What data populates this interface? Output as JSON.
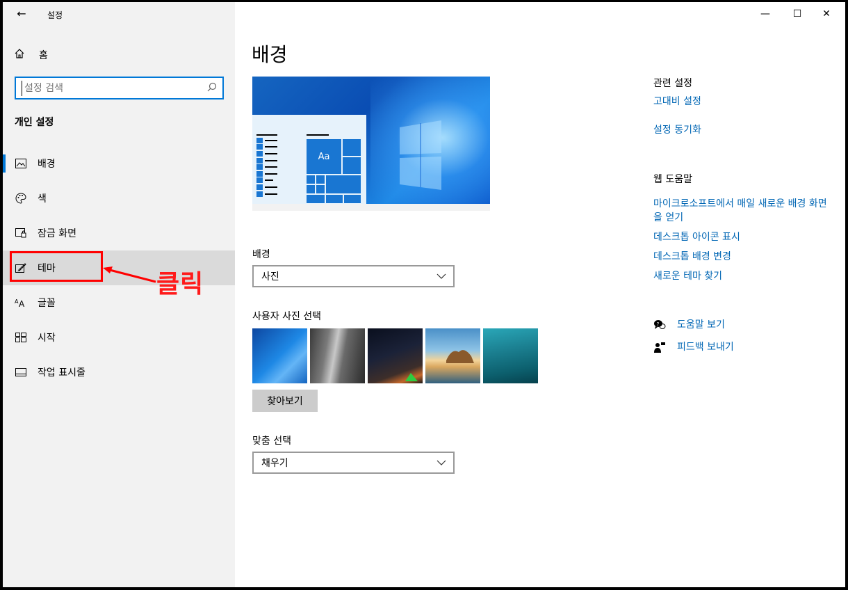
{
  "app": {
    "title": "설정",
    "back_glyph": "←"
  },
  "window_controls": {
    "minimize": "—",
    "maximize": "☐",
    "close": "✕"
  },
  "sidebar": {
    "home_label": "홈",
    "search_placeholder": "설정 검색",
    "section_title": "개인 설정",
    "items": [
      {
        "label": "배경",
        "icon": "picture-icon",
        "glyph": "🖼"
      },
      {
        "label": "색",
        "icon": "palette-icon",
        "glyph": "🎨"
      },
      {
        "label": "잠금 화면",
        "icon": "lock-screen-icon",
        "glyph": "⎘"
      },
      {
        "label": "테마",
        "icon": "theme-brush-icon",
        "glyph": "✎"
      },
      {
        "label": "글꼴",
        "icon": "font-icon",
        "glyph": "ᴬA"
      },
      {
        "label": "시작",
        "icon": "start-grid-icon",
        "glyph": "⊞"
      },
      {
        "label": "작업 표시줄",
        "icon": "taskbar-icon",
        "glyph": "▭"
      }
    ]
  },
  "annotation": {
    "text": "클릭"
  },
  "main": {
    "title": "배경",
    "preview_tile_text": "Aa",
    "background_label": "배경",
    "background_value": "사진",
    "photo_label": "사용자 사진 선택",
    "browse_label": "찾아보기",
    "fit_label": "맞춤 선택",
    "fit_value": "채우기"
  },
  "related": {
    "title": "관련 설정",
    "links": [
      "고대비 설정",
      "설정 동기화"
    ]
  },
  "web_help": {
    "title": "웹 도움말",
    "links": [
      "마이크로소프트에서 매일 새로운 배경 화면을 얻기",
      "데스크톱 아이콘 표시",
      "데스크톱 배경 변경",
      "새로운 테마 찾기"
    ]
  },
  "support": {
    "help_label": "도움말 보기",
    "feedback_label": "피드백 보내기"
  },
  "colors": {
    "accent": "#0078d7",
    "link": "#0066b4",
    "annotation": "#ff0000"
  }
}
